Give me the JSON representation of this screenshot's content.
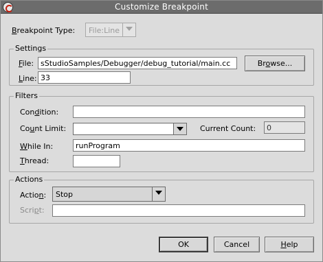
{
  "window": {
    "title": "Customize Breakpoint"
  },
  "breakpoint_type": {
    "label_pre": "",
    "label_key": "B",
    "label_post": "reakpoint Type:",
    "value": "File:Line"
  },
  "settings": {
    "title": "Settings",
    "file": {
      "label_key": "F",
      "label_post": "ile:",
      "value": "sStudioSamples/Debugger/debug_tutorial/main.cc"
    },
    "browse": {
      "label_pre": "Br",
      "label_key": "o",
      "label_post": "wse..."
    },
    "line": {
      "label_key": "L",
      "label_post": "ine:",
      "value": "33"
    }
  },
  "filters": {
    "title": "Filters",
    "condition": {
      "label_pre": "Con",
      "label_key": "d",
      "label_post": "ition:",
      "value": ""
    },
    "count_limit": {
      "label_pre": "Co",
      "label_key": "u",
      "label_post": "nt Limit:",
      "value": ""
    },
    "current_count": {
      "label": "Current Count:",
      "value": "0"
    },
    "while_in": {
      "label_key": "W",
      "label_post": "hile In:",
      "value": "runProgram"
    },
    "thread": {
      "label_key": "T",
      "label_post": "hread:",
      "value": ""
    }
  },
  "actions": {
    "title": "Actions",
    "action": {
      "label_pre": "Actio",
      "label_key": "n",
      "label_post": ":",
      "value": "Stop"
    },
    "script": {
      "label_pre": "Scri",
      "label_key": "p",
      "label_post": "t:",
      "value": ""
    }
  },
  "buttons": {
    "ok": {
      "label": "OK"
    },
    "cancel": {
      "label": "Cancel"
    },
    "help": {
      "label_key": "H",
      "label_post": "elp"
    }
  }
}
